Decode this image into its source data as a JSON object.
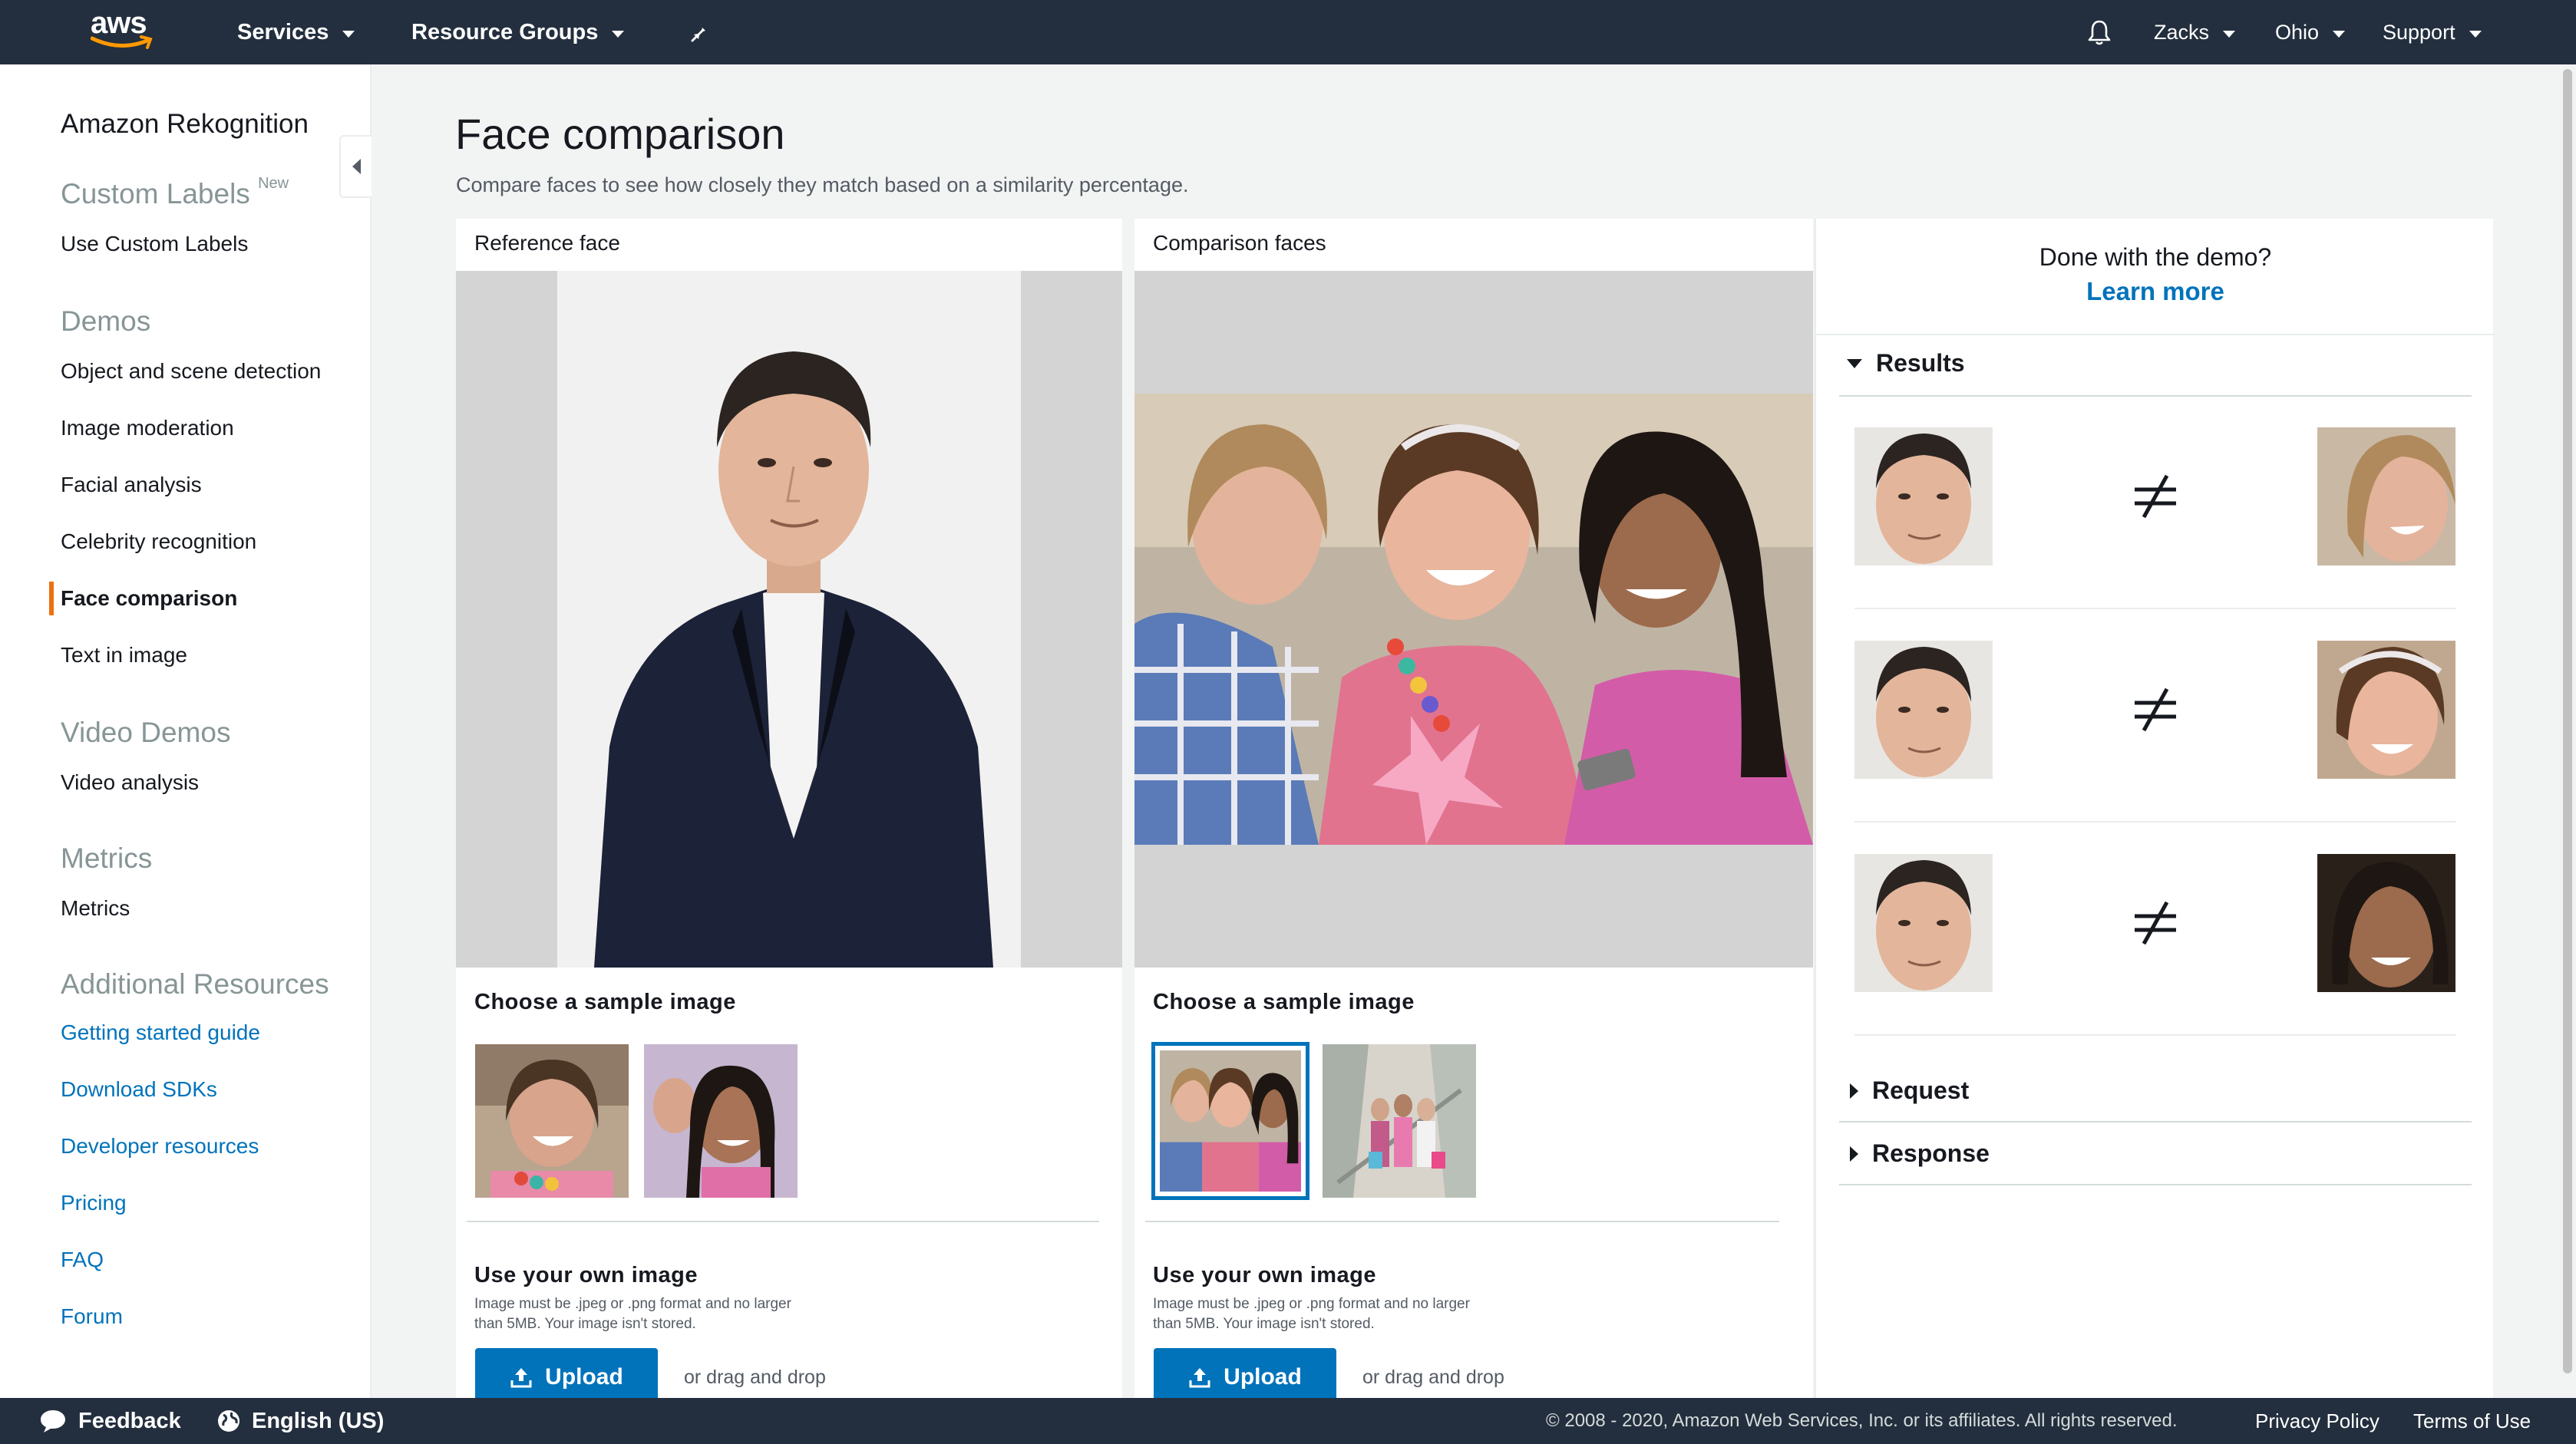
{
  "topbar": {
    "logo_text": "aws",
    "services_label": "Services",
    "resource_groups_label": "Resource Groups",
    "user_label": "Zacks",
    "region_label": "Ohio",
    "support_label": "Support"
  },
  "sidebar": {
    "title": "Amazon Rekognition",
    "custom_labels_section": "Custom Labels",
    "custom_labels_badge": "New",
    "use_custom_labels": "Use Custom Labels",
    "demos_section": "Demos",
    "demos": [
      "Object and scene detection",
      "Image moderation",
      "Facial analysis",
      "Celebrity recognition",
      "Face comparison",
      "Text in image"
    ],
    "video_section": "Video Demos",
    "video_analysis": "Video analysis",
    "metrics_section": "Metrics",
    "metrics_link": "Metrics",
    "resources_section": "Additional Resources",
    "resources": [
      "Getting started guide",
      "Download SDKs",
      "Developer resources",
      "Pricing",
      "FAQ",
      "Forum"
    ]
  },
  "main": {
    "title": "Face comparison",
    "subtitle": "Compare faces to see how closely they match based on a similarity percentage.",
    "reference_label": "Reference face",
    "comparison_label": "Comparison faces",
    "choose_sample": "Choose a sample image",
    "own_image_title": "Use your own image",
    "own_image_note": "Image must be .jpeg or .png format and no larger than 5MB. Your image isn't stored.",
    "upload_label": "Upload",
    "drag_drop": "or drag and drop"
  },
  "results_panel": {
    "done_question": "Done with the demo?",
    "learn_more": "Learn more",
    "results_label": "Results",
    "request_label": "Request",
    "response_label": "Response",
    "comparison_symbol": "≠"
  },
  "footer": {
    "feedback": "Feedback",
    "language": "English (US)",
    "copyright": "© 2008 - 2020, Amazon Web Services, Inc. or its affiliates. All rights reserved.",
    "privacy": "Privacy Policy",
    "terms": "Terms of Use"
  },
  "colors": {
    "nav_bg": "#232f3e",
    "link_blue": "#0073bb",
    "active_orange": "#ec7211",
    "page_bg": "#f2f3f3"
  }
}
